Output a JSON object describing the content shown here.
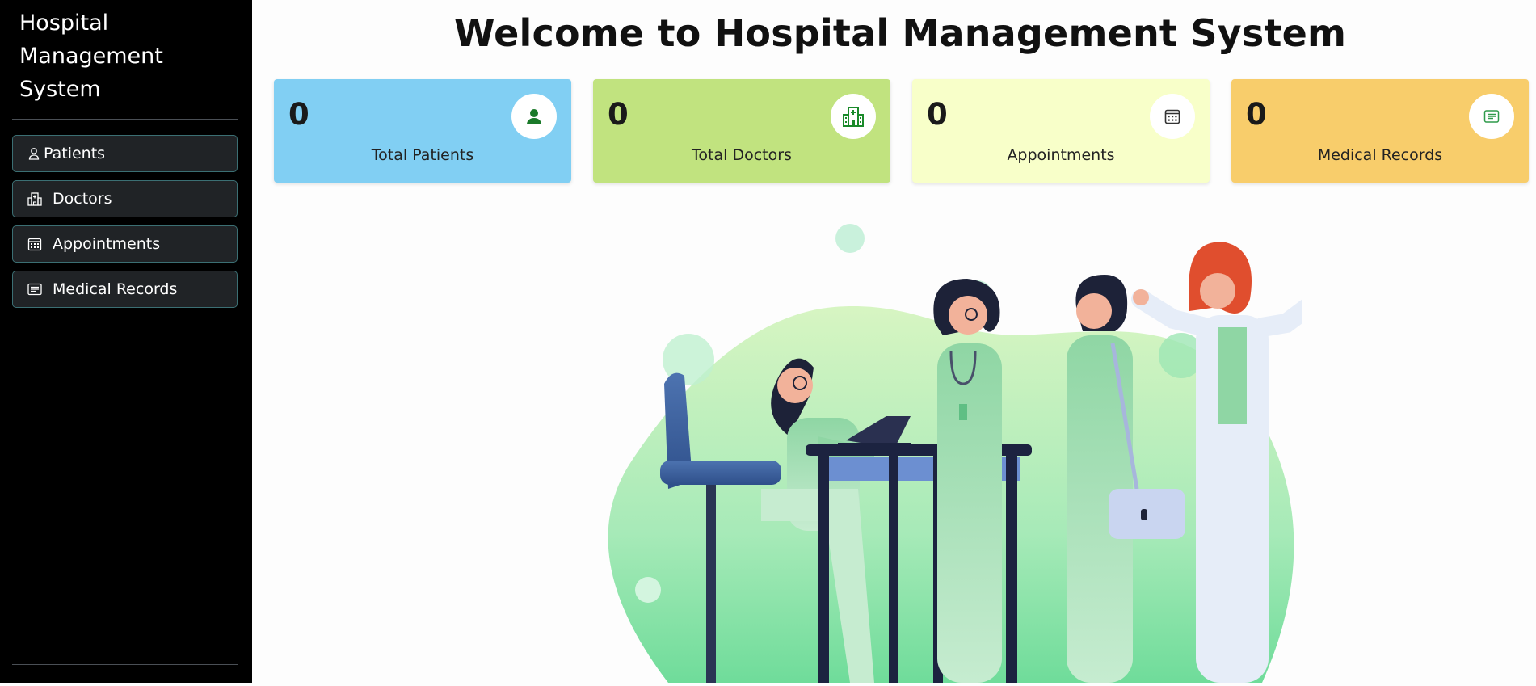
{
  "sidebar": {
    "brand": "Hospital Management System",
    "items": [
      {
        "label": "Patients",
        "icon": "person-icon"
      },
      {
        "label": "Doctors",
        "icon": "hospital-icon"
      },
      {
        "label": "Appointments",
        "icon": "calendar-icon"
      },
      {
        "label": "Medical Records",
        "icon": "list-icon"
      }
    ]
  },
  "header": {
    "title": "Welcome to Hospital Management System"
  },
  "cards": [
    {
      "value": "0",
      "label": "Total Patients",
      "color": "#81cff3",
      "icon": "person-icon",
      "icon_color": "#1a7a2a"
    },
    {
      "value": "0",
      "label": "Total Doctors",
      "color": "#c1e37f",
      "icon": "hospital-icon",
      "icon_color": "#1a8a2a"
    },
    {
      "value": "0",
      "label": "Appointments",
      "color": "#f8ffc9",
      "icon": "calendar-icon",
      "icon_color": "#333333"
    },
    {
      "value": "0",
      "label": "Medical Records",
      "color": "#f8cd6b",
      "icon": "list-icon",
      "icon_color": "#2e9a4a"
    }
  ],
  "colors": {
    "sidebar_bg": "#000000",
    "nav_border": "#3b6f73",
    "nav_bg": "#202326"
  }
}
